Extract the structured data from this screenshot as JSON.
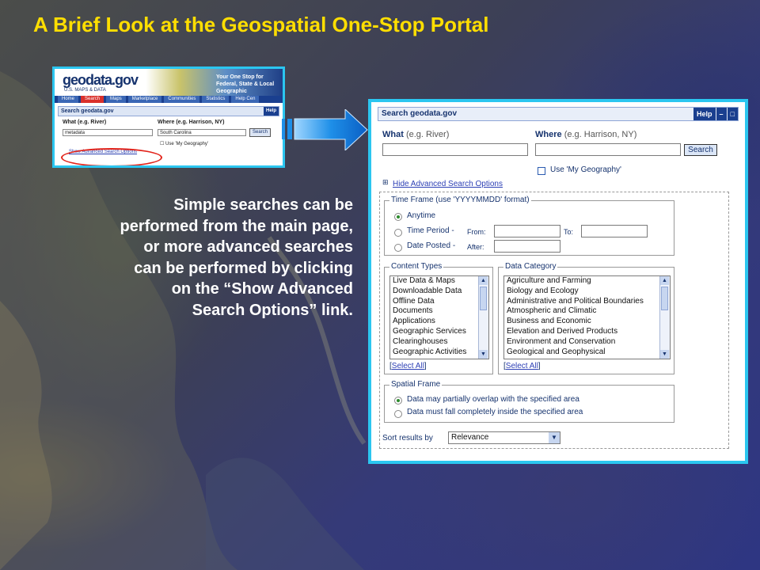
{
  "slide": {
    "title": "A Brief Look at the Geospatial One-Stop Portal",
    "paragraph": "Simple searches can be performed from the main page, or more advanced searches can be performed by clicking on the “Show Advanced Search Options” link."
  },
  "thumbnail": {
    "logo": "geodata.gov",
    "logo_sub": "U.S. MAPS & DATA",
    "tagline": "Your One Stop for Federal, State & Local Geographic",
    "nav": [
      "Home",
      "Search",
      "Maps",
      "Marketplace",
      "Communities",
      "Statistics",
      "Help Cen"
    ],
    "header": "Search geodata.gov",
    "header_btns": "Help",
    "what_label": "What (e.g. River)",
    "what_value": "metadata",
    "where_label": "Where (e.g. Harrison, NY)",
    "where_value": "South Carolina",
    "search_btn": "Search",
    "use_geo": "Use 'My Geography'",
    "advanced_link": "Show Advanced Search Options"
  },
  "panel": {
    "header": "Search geodata.gov",
    "header_buttons": [
      "Help",
      "–",
      "□"
    ],
    "what_label": "What",
    "what_hint": "(e.g. River)",
    "where_label": "Where",
    "where_hint": "(e.g. Harrison, NY)",
    "search_button": "Search",
    "use_geography": "Use 'My Geography'",
    "hide_link": "Hide Advanced Search Options",
    "expand_icon": "⊞",
    "time_frame": {
      "legend": "Time Frame (use 'YYYYMMDD' format)",
      "anytime": "Anytime",
      "time_period": "Time Period -",
      "from": "From:",
      "to": "To:",
      "date_posted": "Date Posted -",
      "after": "After:"
    },
    "content_types": {
      "legend": "Content Types",
      "items": [
        "Live Data & Maps",
        "Downloadable Data",
        "Offline Data",
        "Documents",
        "Applications",
        "Geographic Services",
        "Clearinghouses",
        "Geographic Activities"
      ],
      "select_all": "Select All"
    },
    "data_category": {
      "legend": "Data Category",
      "items": [
        "Agriculture and Farming",
        "Biology and Ecology",
        "Administrative and Political Boundaries",
        "Atmospheric and Climatic",
        "Business and Economic",
        "Elevation and Derived Products",
        "Environment and Conservation",
        "Geological and Geophysical"
      ],
      "select_all": "Select All"
    },
    "spatial_frame": {
      "legend": "Spatial Frame",
      "option1": "Data may partially overlap with the specified area",
      "option2": "Data must fall completely inside the specified area"
    },
    "sort_label": "Sort results by",
    "sort_value": "Relevance"
  },
  "colors": {
    "title": "#ffde00",
    "frame_border": "#2bc6f0",
    "highlight_ring": "#e2231a",
    "arrow": "#1e8fe8"
  }
}
